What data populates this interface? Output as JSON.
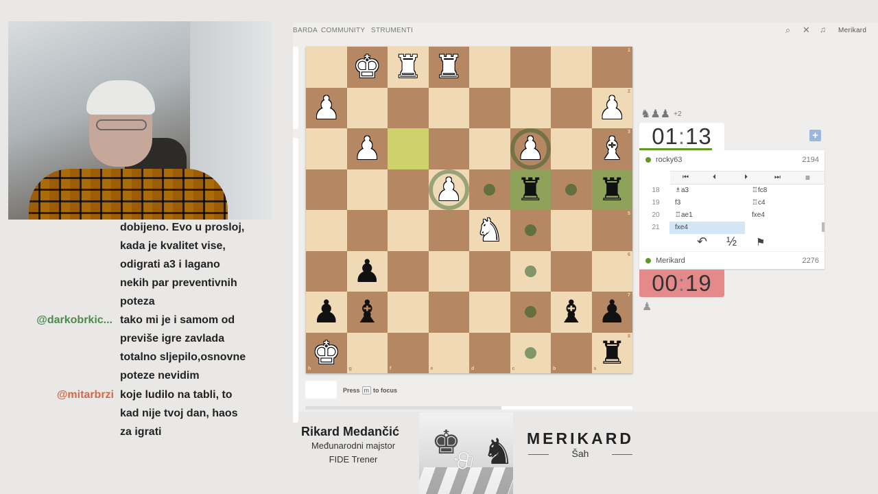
{
  "nav": {
    "items": [
      "BARDA",
      "COMMUNITY",
      "STRUMENTI"
    ],
    "username": "Merikard"
  },
  "chat": [
    {
      "user": "",
      "lines": [
        "dobijeno. Evo u prosloj,",
        "kada je kvalitet vise,",
        "odigrati a3 i lagano",
        "nekih par preventivnih",
        "poteza"
      ]
    },
    {
      "user": "@darkobrkic...",
      "user_color": "#4a8a4a",
      "lines": [
        "tako mi je i samom od",
        "previše igre zavlada",
        "totalno sljepilo,osnovne",
        "poteze nevidim"
      ]
    },
    {
      "user": "@mitarbrzi",
      "user_color": "#d06a4a",
      "lines": [
        "koje ludilo na tabli, to",
        "kad nije tvoj dan, haos",
        "za igrati"
      ]
    }
  ],
  "board": {
    "files": [
      "h",
      "g",
      "f",
      "e",
      "d",
      "c",
      "b",
      "a"
    ],
    "ranks": [
      "1",
      "2",
      "3",
      "4",
      "5",
      "6",
      "7",
      "8"
    ],
    "pieces": [
      {
        "r": 0,
        "c": 1,
        "glyph": "♚",
        "color": "white"
      },
      {
        "r": 0,
        "c": 2,
        "glyph": "♜",
        "color": "white"
      },
      {
        "r": 0,
        "c": 3,
        "glyph": "♜",
        "color": "white"
      },
      {
        "r": 1,
        "c": 0,
        "glyph": "♟",
        "color": "white"
      },
      {
        "r": 1,
        "c": 7,
        "glyph": "♟",
        "color": "white"
      },
      {
        "r": 2,
        "c": 1,
        "glyph": "♟",
        "color": "white"
      },
      {
        "r": 2,
        "c": 5,
        "glyph": "♟",
        "color": "white"
      },
      {
        "r": 2,
        "c": 7,
        "glyph": "♝",
        "color": "white"
      },
      {
        "r": 3,
        "c": 3,
        "glyph": "♟",
        "color": "white"
      },
      {
        "r": 3,
        "c": 5,
        "glyph": "♜",
        "color": "black"
      },
      {
        "r": 3,
        "c": 7,
        "glyph": "♜",
        "color": "black"
      },
      {
        "r": 4,
        "c": 4,
        "glyph": "♞",
        "color": "white"
      },
      {
        "r": 5,
        "c": 1,
        "glyph": "♟",
        "color": "black"
      },
      {
        "r": 6,
        "c": 0,
        "glyph": "♟",
        "color": "black"
      },
      {
        "r": 6,
        "c": 1,
        "glyph": "♝",
        "color": "black"
      },
      {
        "r": 6,
        "c": 6,
        "glyph": "♝",
        "color": "black"
      },
      {
        "r": 6,
        "c": 7,
        "glyph": "♟",
        "color": "black"
      },
      {
        "r": 7,
        "c": 0,
        "glyph": "♚",
        "color": "white"
      },
      {
        "r": 7,
        "c": 7,
        "glyph": "♜",
        "color": "black"
      }
    ],
    "last_move": [
      {
        "r": 2,
        "c": 2
      }
    ],
    "selected": [
      {
        "r": 3,
        "c": 5
      },
      {
        "r": 3,
        "c": 7
      }
    ],
    "dots": [
      {
        "r": 3,
        "c": 4
      },
      {
        "r": 3,
        "c": 6
      },
      {
        "r": 4,
        "c": 5
      },
      {
        "r": 5,
        "c": 5
      },
      {
        "r": 6,
        "c": 5
      },
      {
        "r": 7,
        "c": 5
      }
    ],
    "rings": [
      {
        "r": 2,
        "c": 5
      },
      {
        "r": 3,
        "c": 3
      }
    ]
  },
  "press_hint": {
    "prefix": "Press",
    "key": "m",
    "suffix": "to focus"
  },
  "progress": 0.6,
  "material_top": {
    "pieces": "♞♟♟",
    "diff": "+2"
  },
  "clock_top": {
    "min": "01",
    "sec": "13"
  },
  "clock_bottom": {
    "min": "00",
    "sec": "19"
  },
  "player_top": {
    "name": "rocky63",
    "rating": "2194"
  },
  "player_bottom": {
    "name": "Merikard",
    "rating": "2276"
  },
  "controls": [
    "⏮",
    "⏴",
    "⏵",
    "⏭",
    "≡"
  ],
  "moves": [
    {
      "num": "18",
      "white": "♗a3",
      "black": "♖fc8"
    },
    {
      "num": "19",
      "white": "f3",
      "black": "♖c4"
    },
    {
      "num": "20",
      "white": "♖ae1",
      "black": "fxe4"
    },
    {
      "num": "21",
      "white": "fxe4",
      "black": ""
    }
  ],
  "actions": {
    "takeback": "↶",
    "draw": "½",
    "resign": "⚑"
  },
  "brand": {
    "name": "Rikard Medančić",
    "title1": "Međunarodni majstor",
    "title2": "FIDE Trener",
    "logo": "MERIKARD",
    "logo_sub": "Šah"
  }
}
